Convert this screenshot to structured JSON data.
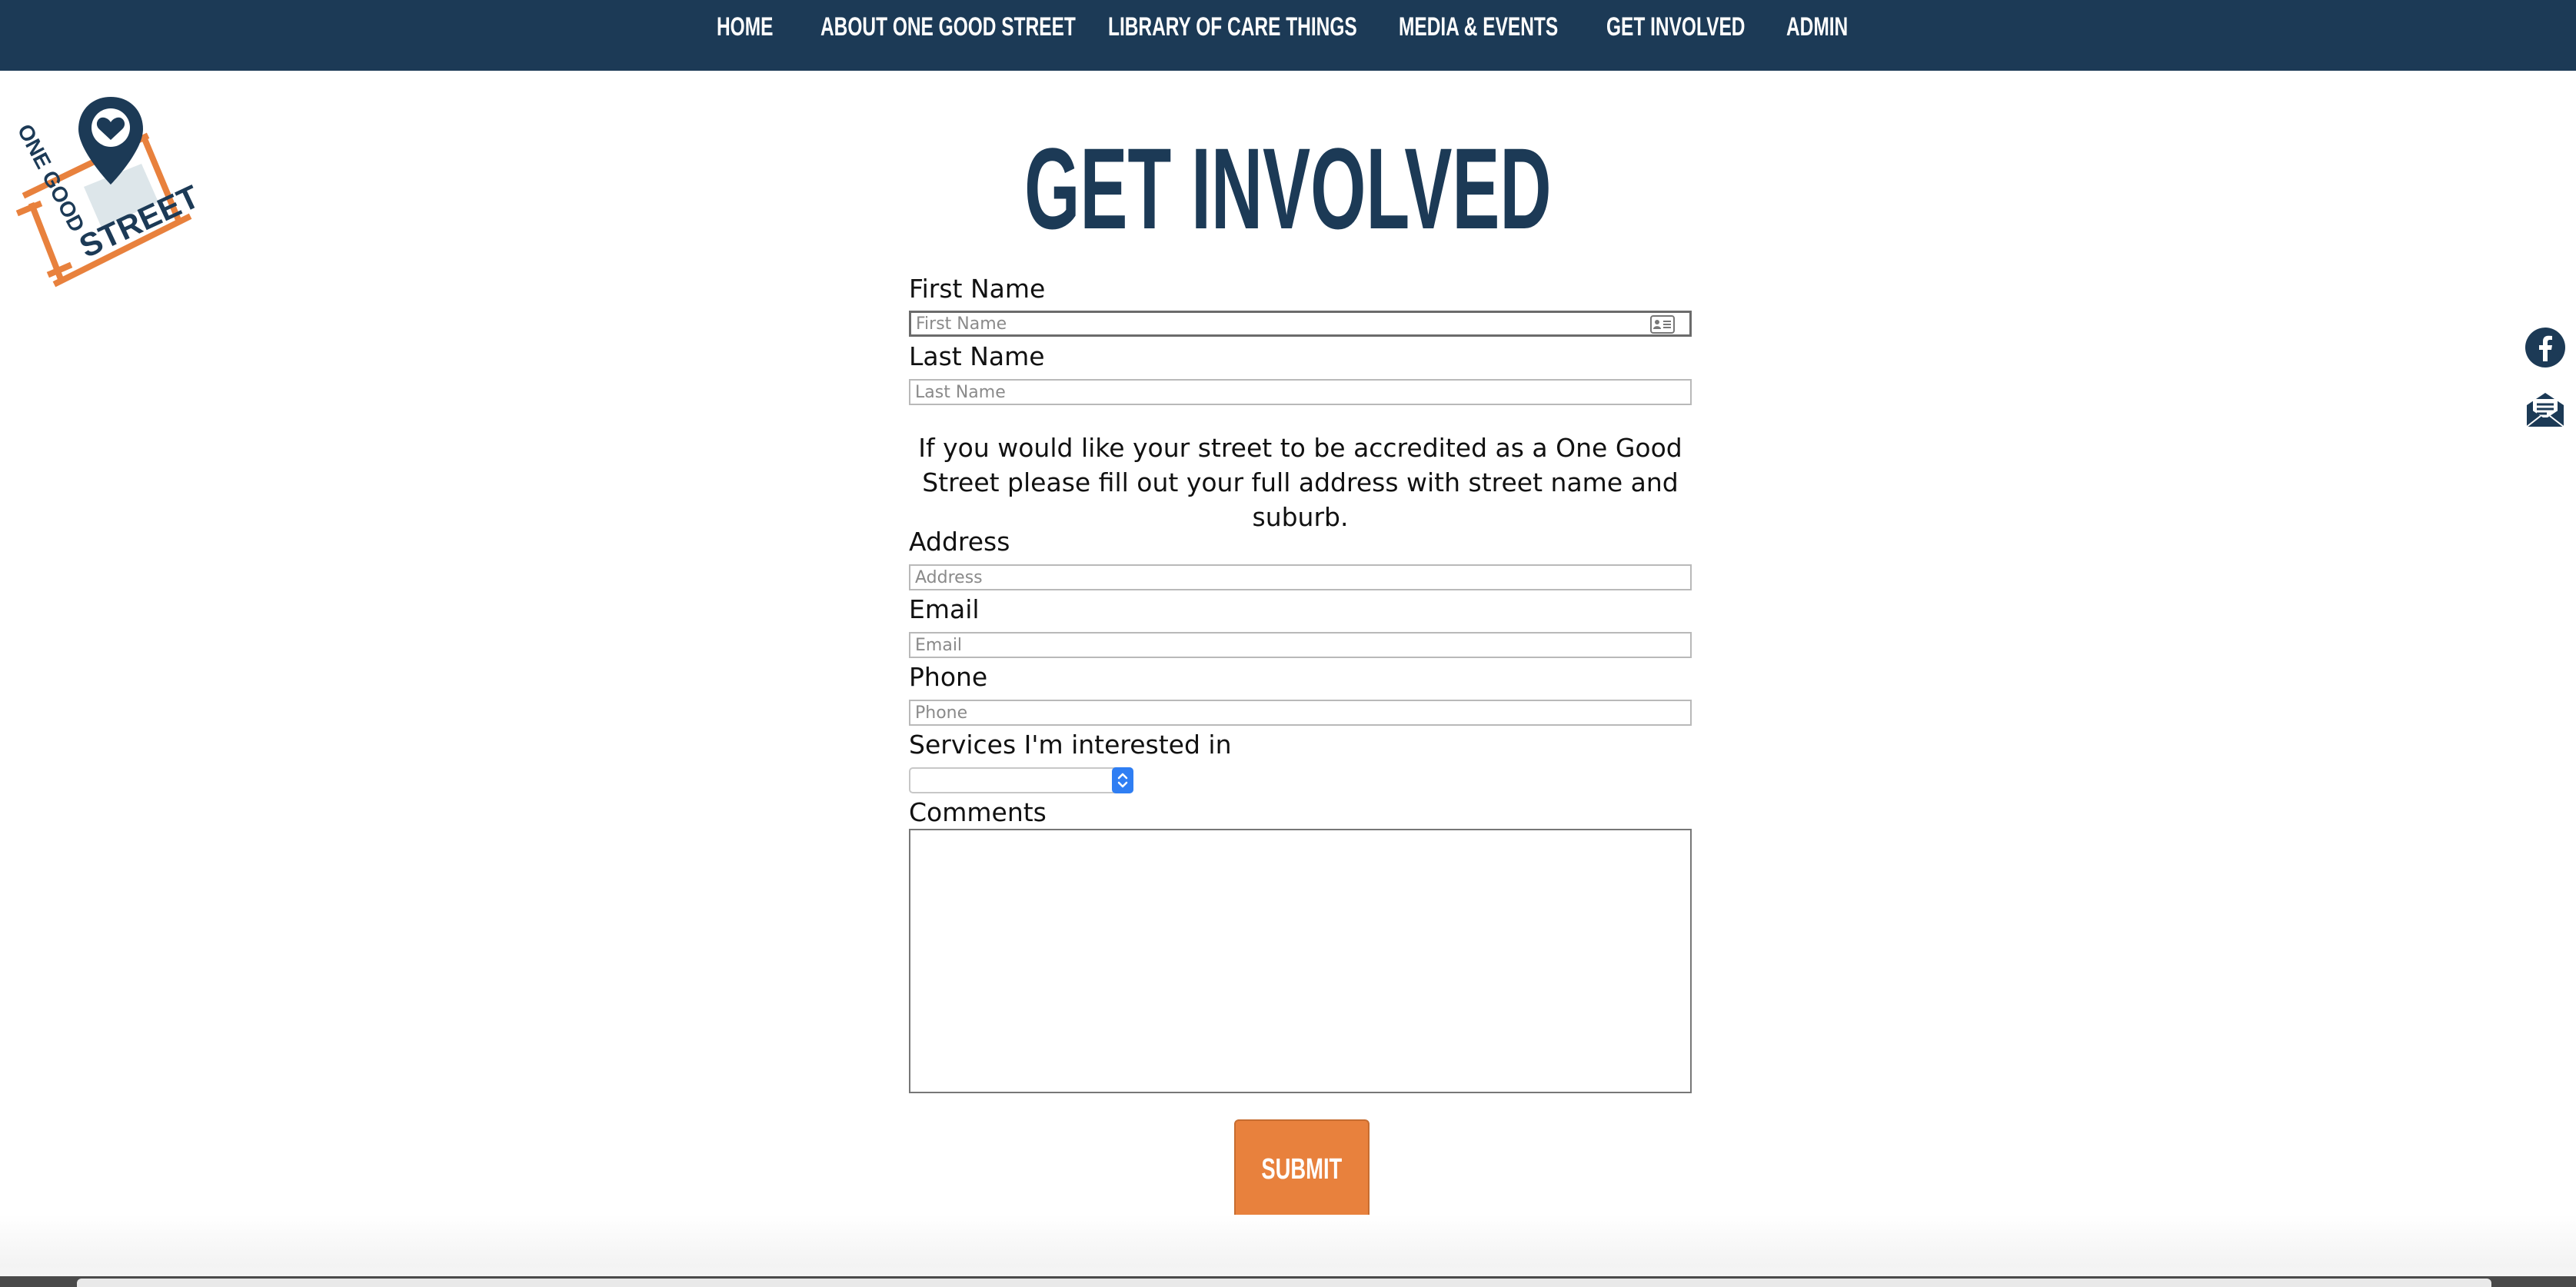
{
  "nav": {
    "items": [
      {
        "label": "HOME"
      },
      {
        "label": "ABOUT ONE GOOD STREET"
      },
      {
        "label": "LIBRARY OF CARE THINGS"
      },
      {
        "label": "MEDIA & EVENTS"
      },
      {
        "label": "GET INVOLVED"
      },
      {
        "label": "ADMIN"
      }
    ],
    "background": "#1c3a56"
  },
  "logo": {
    "line1": "ONE GOOD",
    "line2": "STREET",
    "icon": "heart-map-pin-icon"
  },
  "page": {
    "title": "GET INVOLVED"
  },
  "form": {
    "first_name": {
      "label": "First Name",
      "placeholder": "First Name"
    },
    "last_name": {
      "label": "Last Name",
      "placeholder": "Last Name"
    },
    "notice": "If you would like your street to be accredited as a One Good Street please fill out your full address with street name and suburb.",
    "address": {
      "label": "Address",
      "placeholder": "Address"
    },
    "email": {
      "label": "Email",
      "placeholder": "Email"
    },
    "phone": {
      "label": "Phone",
      "placeholder": "Phone"
    },
    "services": {
      "label": "Services I'm interested in",
      "selected": ""
    },
    "comments": {
      "label": "Comments"
    },
    "submit_label": "SUBMIT"
  },
  "social": {
    "facebook_icon": "facebook-icon",
    "newsletter_icon": "newsletter-icon"
  },
  "colors": {
    "accent": "#e8813d",
    "brand": "#1c3a56"
  }
}
